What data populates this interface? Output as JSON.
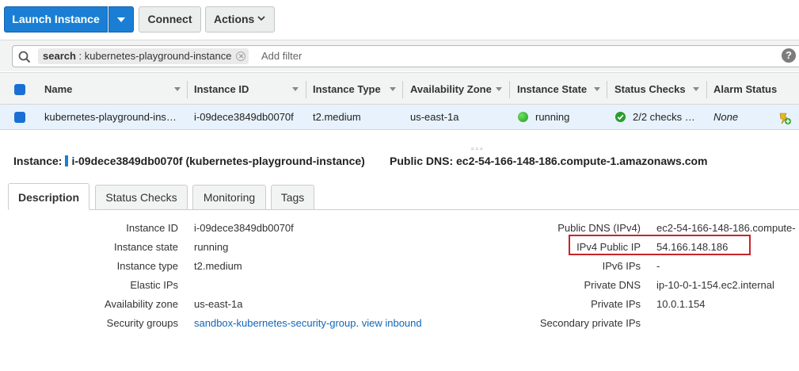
{
  "toolbar": {
    "launch_label": "Launch Instance",
    "connect_label": "Connect",
    "actions_label": "Actions"
  },
  "filter": {
    "token_key": "search",
    "token_value": " : kubernetes-playground-instance",
    "add_filter_placeholder": "Add filter",
    "help_label": "?"
  },
  "table": {
    "columns": [
      "Name",
      "Instance ID",
      "Instance Type",
      "Availability Zone",
      "Instance State",
      "Status Checks",
      "Alarm Status"
    ],
    "row": {
      "name": "kubernetes-playground-ins…",
      "instance_id": "i-09dece3849db0070f",
      "instance_type": "t2.medium",
      "availability_zone": "us-east-1a",
      "instance_state": "running",
      "status_checks": "2/2 checks …",
      "alarm_status": "None"
    }
  },
  "splitter_glyph": "▫▫▫",
  "summary": {
    "instance_label": "Instance:",
    "instance_value": "i-09dece3849db0070f (kubernetes-playground-instance)",
    "public_dns_label": "Public DNS:",
    "public_dns_value": "ec2-54-166-148-186.compute-1.amazonaws.com"
  },
  "tabs": [
    "Description",
    "Status Checks",
    "Monitoring",
    "Tags"
  ],
  "details_left": [
    {
      "label": "Instance ID",
      "value": "i-09dece3849db0070f"
    },
    {
      "label": "Instance state",
      "value": "running"
    },
    {
      "label": "Instance type",
      "value": "t2.medium"
    },
    {
      "label": "Elastic IPs",
      "value": ""
    },
    {
      "label": "Availability zone",
      "value": "us-east-1a"
    },
    {
      "label": "Security groups",
      "value": "sandbox-kubernetes-security-group",
      "value2": ". ",
      "link2": "view inbound"
    }
  ],
  "details_right": [
    {
      "label": "Public DNS (IPv4)",
      "value": "ec2-54-166-148-186.compute-"
    },
    {
      "label": "IPv4 Public IP",
      "value": "54.166.148.186"
    },
    {
      "label": "IPv6 IPs",
      "value": "-"
    },
    {
      "label": "Private DNS",
      "value": "ip-10-0-1-154.ec2.internal"
    },
    {
      "label": "Private IPs",
      "value": "10.0.1.154"
    },
    {
      "label": "Secondary private IPs",
      "value": ""
    }
  ],
  "colors": {
    "primary_button": "#1a7fd4",
    "running_green": "#1f9b1a",
    "highlight_red": "#c6242b",
    "link_blue": "#1166bb"
  }
}
